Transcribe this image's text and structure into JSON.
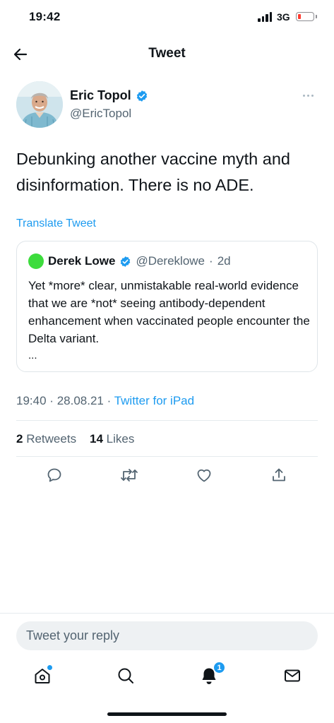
{
  "status_bar": {
    "time": "19:42",
    "network": "3G",
    "battery_level": 0.1,
    "battery_color": "#ff3b30"
  },
  "nav": {
    "title": "Tweet",
    "back_icon": "arrow-left-icon"
  },
  "tweet": {
    "author_name": "Eric Topol",
    "author_handle": "@EricTopol",
    "verified": true,
    "text": "Debunking another vaccine myth and disinformation. There is no ADE.",
    "translate_label": "Translate Tweet",
    "time": "19:40",
    "date": "28.08.21",
    "separator": "·",
    "source": "Twitter for iPad",
    "retweets_count": "2",
    "retweets_label": "Retweets",
    "likes_count": "14",
    "likes_label": "Likes"
  },
  "quote": {
    "author_name": "Derek Lowe",
    "author_handle": "@Dereklowe",
    "age": "2d",
    "verified": true,
    "avatar_color": "#3ddc3d",
    "text": "Yet *more* clear, unmistakable real-world evidence that we are *not* seeing antibody-dependent enhancement when vaccinated people encounter the Delta variant.",
    "ellipsis": "..."
  },
  "actions": [
    "reply-icon",
    "retweet-icon",
    "like-icon",
    "share-icon"
  ],
  "reply": {
    "placeholder": "Tweet your reply"
  },
  "tab_bar": {
    "tabs": [
      "home-icon",
      "search-icon",
      "notifications-icon",
      "messages-icon"
    ],
    "notifications_badge": "1"
  },
  "colors": {
    "accent": "#1d9bf0",
    "text": "#0f1419",
    "secondary": "#536471",
    "divider": "#e6ebee"
  }
}
